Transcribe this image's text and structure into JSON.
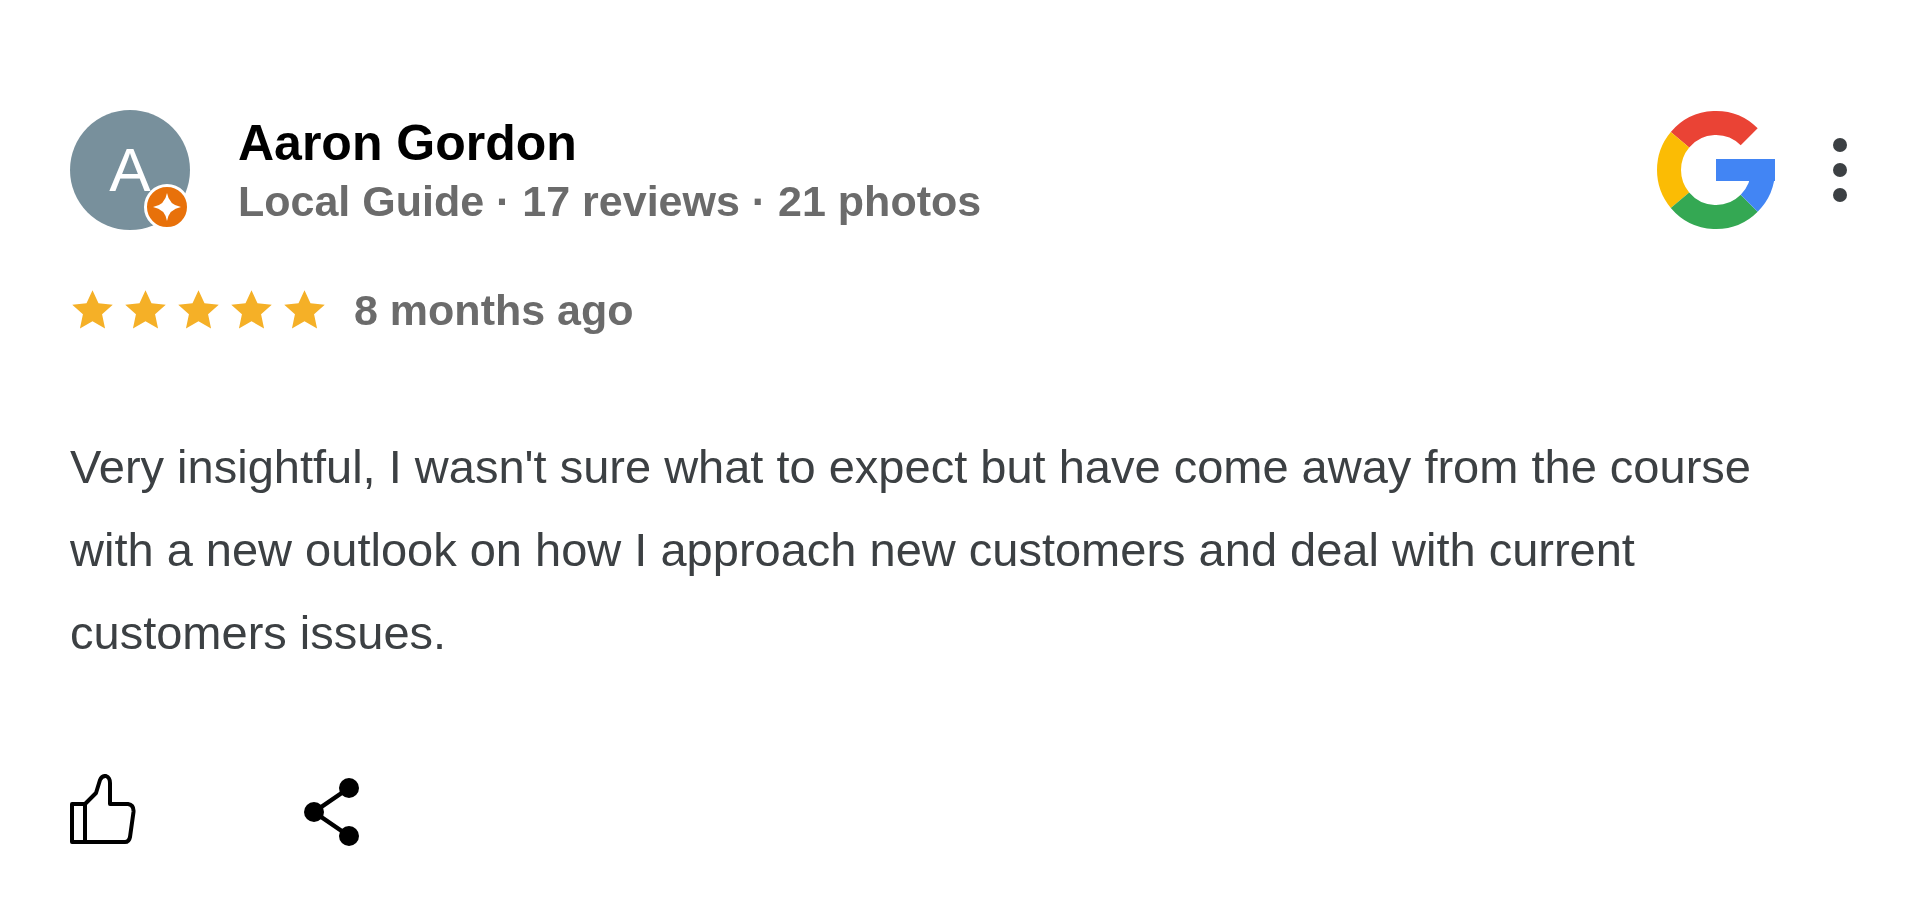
{
  "review": {
    "author": {
      "initial": "A",
      "name": "Aaron Gordon",
      "local_guide": true,
      "details": "Local Guide · 17 reviews · 21 photos"
    },
    "stars": 5,
    "time": "8 months ago",
    "text": "Very insightful, I wasn't sure what to expect but have come away from the course with a new outlook on how I approach new customers and deal with current customers issues."
  }
}
